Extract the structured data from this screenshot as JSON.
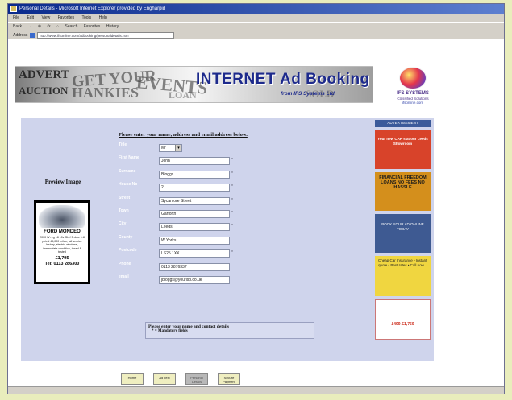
{
  "window": {
    "title": "Personal Details - Microsoft Internet Explorer provided by Engharpid"
  },
  "menu": [
    "File",
    "Edit",
    "View",
    "Favorites",
    "Tools",
    "Help"
  ],
  "toolbar": {
    "back": "Back",
    "forward": "→",
    "stop": "⊗",
    "refresh": "⟳",
    "home": "⌂",
    "search": "Search",
    "favorites": "Favorites",
    "history": "History"
  },
  "address": {
    "label": "Address",
    "url": "http://www.ifsonline.com/adbooking/personaldetails.htm"
  },
  "banner": {
    "title": "INTERNET Ad Booking",
    "subtitle": "from IFS Systems Ltd",
    "collage": [
      "ADVERT",
      "AUCTION",
      "GET YOUR",
      "HANKIES",
      "EVENTS",
      "LOAN",
      "SOLD"
    ]
  },
  "logo": {
    "name": "IFS SYSTEMS",
    "tagline": "Classified Solutions",
    "link": "ifsonline.com"
  },
  "form": {
    "instruction": "Please enter your name, address and email address below.",
    "fields": [
      {
        "label": "Title",
        "value": "Mr",
        "select": true
      },
      {
        "label": "First Name",
        "value": "John"
      },
      {
        "label": "Surname",
        "value": "Bloggs"
      },
      {
        "label": "House No",
        "value": "2"
      },
      {
        "label": "Street",
        "value": "Sycamore Street"
      },
      {
        "label": "Town",
        "value": "Garforth"
      },
      {
        "label": "City",
        "value": "Leeds"
      },
      {
        "label": "County",
        "value": "W Yorks"
      },
      {
        "label": "Postcode",
        "value": "LS25 1XX"
      },
      {
        "label": "Phone",
        "value": "0113 2876337"
      },
      {
        "label": "email",
        "value": "jbloggs@yourisp.co.uk"
      }
    ],
    "required_marker": "*",
    "note_line1": "Please enter your name and contact details",
    "note_line2": "* = Mandatory fields"
  },
  "preview": {
    "title": "Preview Image",
    "heading": "FORD MONDEO",
    "description": "2000 W reg 18 10v GLX 5 door 1.8 petrol 45,000 miles, full service history, electric windows, immaculate condition, taxed & tested",
    "price": "£1,795",
    "phone": "Tel: 0113 286300"
  },
  "buttons": {
    "home": "Home",
    "ad_text": "Ad Text",
    "personal": "Personal Details",
    "secure": "Secure Payment"
  },
  "sidebar_ads": [
    "ADVERTISEMENT",
    "Your new CAR's at our Leeds Showroom",
    "FINANCIAL FREEDOM LOANS NO FEES NO HASSLE",
    "BOOK YOUR AD ONLINE TODAY",
    "Cheap Car Insurance • Instant quote • Best rates • Call now",
    "£499-£1,750"
  ],
  "colors": {
    "page_background": "#e9edbc",
    "form_panel": "#cfd4ec",
    "brand_blue": "#1d2a8c",
    "title_bar": "#0a2a8c"
  }
}
